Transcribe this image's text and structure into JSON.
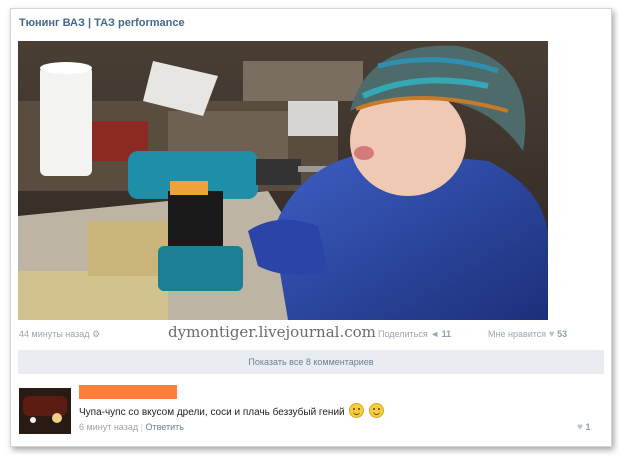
{
  "post": {
    "title": "Тюнинг ВАЗ | ТАЗ performance",
    "time": "44 минуты назад",
    "watermark": "dymontiger.livejournal.com",
    "share_label": "Поделиться",
    "share_count": "11",
    "like_label": "Мне нравится",
    "like_count": "53",
    "show_comments": "Показать все 8 комментариев"
  },
  "comment": {
    "text": "Чупа-чупс со вкусом дрели, соси и плачь беззубый гений",
    "time": "6 минут назад",
    "reply": "Ответить",
    "likes": "1"
  },
  "icons": {
    "settings": "gear-icon",
    "share": "megaphone-icon",
    "like": "heart-icon",
    "emoji": "smile-emoji-icon"
  },
  "colors": {
    "link": "#45688e",
    "name_redaction": "#ff7f3a",
    "bar_bg": "#e9edf1"
  }
}
